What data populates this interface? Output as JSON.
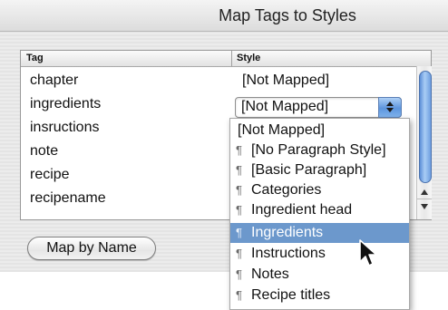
{
  "dialog": {
    "title": "Map Tags to Styles",
    "table": {
      "headers": {
        "tag": "Tag",
        "style": "Style"
      },
      "rows": [
        {
          "tag": "chapter",
          "style": "[Not Mapped]"
        },
        {
          "tag": "ingredients",
          "style": "[Not Mapped]"
        },
        {
          "tag": "insructions",
          "style": ""
        },
        {
          "tag": "note",
          "style": ""
        },
        {
          "tag": "recipe",
          "style": ""
        },
        {
          "tag": "recipename",
          "style": ""
        }
      ]
    },
    "map_button_label": "Map by Name"
  },
  "dropdown": {
    "selected_index": 5,
    "items": [
      {
        "label": "[Not Mapped]",
        "icon": ""
      },
      {
        "label": "[No Paragraph Style]",
        "icon": "paragraph-style-icon"
      },
      {
        "label": "[Basic Paragraph]",
        "icon": "paragraph-style-icon"
      },
      {
        "label": "Categories",
        "icon": "paragraph-style-icon"
      },
      {
        "label": "Ingredient head",
        "icon": "paragraph-style-icon"
      },
      {
        "label": "Ingredients",
        "icon": "paragraph-style-icon"
      },
      {
        "label": "Instructions",
        "icon": "paragraph-style-icon"
      },
      {
        "label": "Notes",
        "icon": "paragraph-style-icon"
      },
      {
        "label": "Recipe titles",
        "icon": "paragraph-style-icon"
      }
    ]
  },
  "colors": {
    "selection": "#6c98cc",
    "aqua_blue": "#5c95dd"
  }
}
